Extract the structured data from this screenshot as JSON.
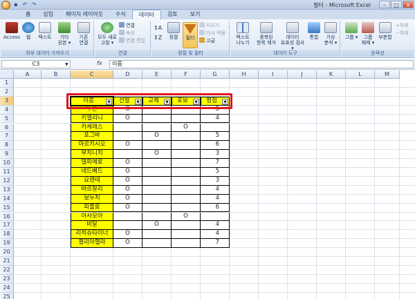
{
  "window": {
    "title": "필터 - Microsoft Excel",
    "qat_icons": [
      "save-icon",
      "undo-icon",
      "redo-icon"
    ]
  },
  "ribbon_tabs": [
    "홈",
    "삽입",
    "페이지 레이아웃",
    "수식",
    "데이터",
    "검토",
    "보기"
  ],
  "active_tab": "데이터",
  "ribbon": {
    "external_group": {
      "label": "외부 데이터 가져오기",
      "access": "Access",
      "web": "웹",
      "text": "텍스트",
      "other_line1": "기타",
      "other_line2": "원본 ▾",
      "existing_line1": "기존",
      "existing_line2": "연결"
    },
    "connections_group": {
      "label": "연결",
      "refresh_line1": "모두 새로",
      "refresh_line2": "고침 ▾",
      "connections": "연결",
      "properties": "속성",
      "edit_links": "연결 편집"
    },
    "sort_filter_group": {
      "label": "정렬 및 필터",
      "sort": "정렬",
      "filter": "필터",
      "clear": "지우기",
      "reapply": "다시 적용",
      "advanced": "고급"
    },
    "data_tools_group": {
      "label": "데이터 도구",
      "text_to_col_line1": "텍스트",
      "text_to_col_line2": "나누기",
      "remove_dup_line1": "중복된",
      "remove_dup_line2": "항목 제거",
      "validation_line1": "데이터",
      "validation_line2": "유효성 검사 ▾",
      "consolidate": "통합",
      "whatif_line1": "가상",
      "whatif_line2": "분석 ▾"
    },
    "outline_group": {
      "label": "윤곽선",
      "group_btn": "그룹 ▾",
      "ungroup_line1": "그룹",
      "ungroup_line2": "해제 ▾",
      "subtotal": "부분합",
      "show_detail": "하위",
      "hide_detail": "하위"
    }
  },
  "formula_bar": {
    "name_box": "C3",
    "fx": "fx",
    "content": "이름"
  },
  "columns": [
    "A",
    "B",
    "C",
    "D",
    "E",
    "F",
    "G",
    "H",
    "I",
    "J",
    "K",
    "L",
    "M"
  ],
  "rows": [
    "1",
    "2",
    "3",
    "4",
    "5",
    "6",
    "7",
    "8",
    "9",
    "10",
    "11",
    "12",
    "13",
    "14",
    "15",
    "16",
    "17",
    "18",
    "19",
    "20",
    "21",
    "22",
    "23",
    "24",
    "25"
  ],
  "table": {
    "headers": [
      "이름",
      "선발",
      "교체",
      "후보",
      "평점"
    ],
    "rows": [
      [
        "두폰",
        "O",
        "",
        "",
        "5"
      ],
      [
        "키엘리니",
        "O",
        "",
        "",
        "4"
      ],
      [
        "카세레스",
        "",
        "",
        "O",
        ""
      ],
      [
        "포그바",
        "",
        "O",
        "",
        "5"
      ],
      [
        "마르키시오",
        "O",
        "",
        "",
        "6"
      ],
      [
        "부치니치",
        "",
        "O",
        "",
        "3"
      ],
      [
        "델피에로",
        "O",
        "",
        "",
        "7"
      ],
      [
        "네드베드",
        "O",
        "",
        "",
        "5"
      ],
      [
        "요렌테",
        "O",
        "",
        "",
        "3"
      ],
      [
        "바르잘리",
        "O",
        "",
        "",
        "4"
      ],
      [
        "보누치",
        "O",
        "",
        "",
        "4"
      ],
      [
        "피를로",
        "O",
        "",
        "",
        "6"
      ],
      [
        "아사모아",
        "",
        "",
        "O",
        ""
      ],
      [
        "비달",
        "",
        "O",
        "",
        "4"
      ],
      [
        "리히슈타이너",
        "O",
        "",
        "",
        "4"
      ],
      [
        "콸리아렐라",
        "O",
        "",
        "",
        "7"
      ]
    ]
  },
  "highlight_color": "#e0141e",
  "cell_fill_color": "#ffff00"
}
